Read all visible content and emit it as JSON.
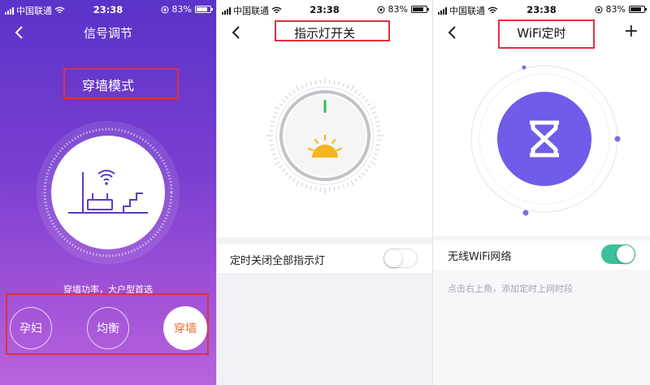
{
  "status_bar": {
    "carrier": "中国联通",
    "time": "23:38",
    "battery": "83%",
    "battery_level": 0.83
  },
  "screen1": {
    "nav_title": "信号调节",
    "mode_title": "穿墙模式",
    "description": "穿墙功率，大户型首选",
    "modes": [
      {
        "label": "孕妇",
        "active": false
      },
      {
        "label": "均衡",
        "active": false
      },
      {
        "label": "穿墙",
        "active": true
      }
    ]
  },
  "screen2": {
    "nav_title": "指示灯开关",
    "row_label": "定时关闭全部指示灯",
    "toggle_on": false
  },
  "screen3": {
    "nav_title": "WiFi定时",
    "row_label": "无线WiFi网络",
    "toggle_on": true,
    "hint": "点击右上角，添加定时上网时段"
  },
  "colors": {
    "purple_top": "#5a33c9",
    "purple_bottom": "#b764dc",
    "accent_orange": "#f06a2e",
    "highlight_red": "#e0313d",
    "toggle_green": "#3cc29a",
    "timer_purple": "#6f5ce8",
    "indicator_green": "#2fbf55",
    "sun_yellow": "#f7b51c"
  },
  "icons": {
    "back": "chevron-left-icon",
    "add": "plus-icon",
    "router": "router-icon",
    "wifi": "wifi-icon",
    "sun": "sun-icon",
    "hourglass": "hourglass-icon",
    "location": "location-icon"
  }
}
